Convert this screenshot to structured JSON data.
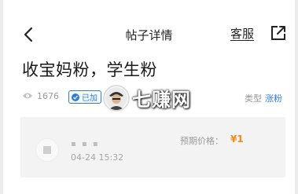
{
  "header": {
    "title": "帖子详情",
    "service_label": "客服"
  },
  "post": {
    "title": "收宝妈粉，学生粉",
    "views": "1676",
    "badge": "已加",
    "type_label": "类型",
    "type_value": "涨粉"
  },
  "watermark": {
    "text": "七赚网"
  },
  "card": {
    "username": "▪ ▪ ▪",
    "date": "04-24 15:32",
    "price_label": "预期价格：",
    "price_value": "¥1"
  },
  "colors": {
    "accent_blue": "#2f7fd6",
    "price_orange": "#f08c1c",
    "card_bg": "#f3f3f3"
  },
  "icons": {
    "back": "chevron-left-icon",
    "share": "external-link-icon",
    "views": "eye-icon",
    "badge": "check-circle-icon"
  }
}
